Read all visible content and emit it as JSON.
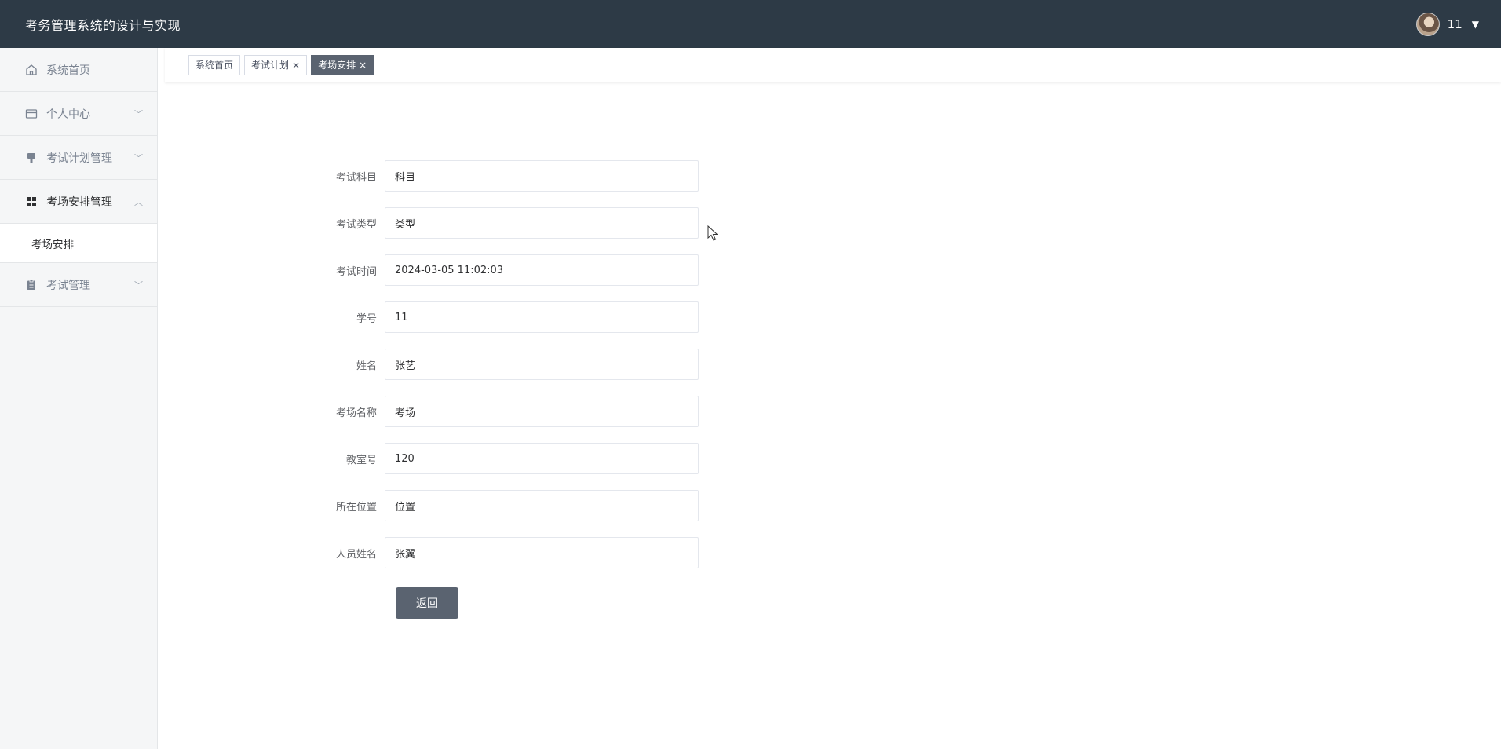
{
  "header": {
    "title": "考务管理系统的设计与实现",
    "user_name": "11",
    "caret": "▼"
  },
  "sidebar": {
    "items": [
      {
        "label": "系统首页",
        "icon": "home-icon"
      },
      {
        "label": "个人中心",
        "icon": "wallet-icon",
        "arrow": "﹀"
      },
      {
        "label": "考试计划管理",
        "icon": "brush-icon",
        "arrow": "﹀"
      },
      {
        "label": "考场安排管理",
        "icon": "grid-icon",
        "arrow": "︿"
      },
      {
        "label": "考试管理",
        "icon": "clipboard-icon",
        "arrow": "﹀"
      }
    ],
    "submenu": {
      "label": "考场安排"
    }
  },
  "tabs": [
    {
      "label": "系统首页"
    },
    {
      "label": "考试计划",
      "close": "×"
    },
    {
      "label": "考场安排",
      "close": "×"
    }
  ],
  "form": {
    "fields": [
      {
        "label": "考试科目",
        "value": "科目"
      },
      {
        "label": "考试类型",
        "value": "类型"
      },
      {
        "label": "考试时间",
        "value": "2024-03-05 11:02:03"
      },
      {
        "label": "学号",
        "value": "11"
      },
      {
        "label": "姓名",
        "value": "张艺"
      },
      {
        "label": "考场名称",
        "value": "考场"
      },
      {
        "label": "教室号",
        "value": "120"
      },
      {
        "label": "所在位置",
        "value": "位置"
      },
      {
        "label": "人员姓名",
        "value": "张翼"
      }
    ],
    "back_label": "返回"
  },
  "colors": {
    "header_bg": "#2d3a46",
    "sidebar_bg": "#f5f6f7",
    "accent": "#5a6370"
  }
}
